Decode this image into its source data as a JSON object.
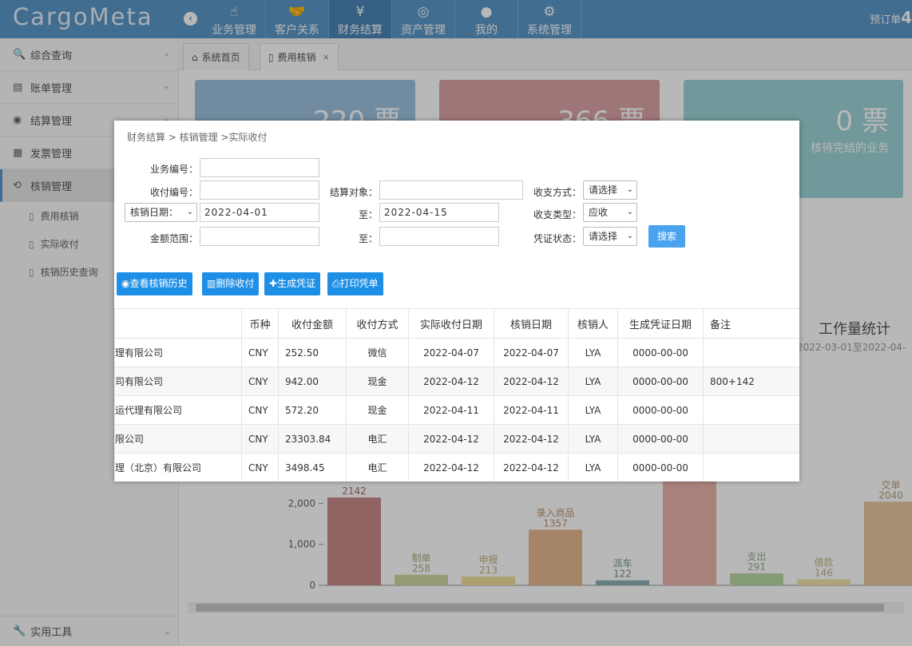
{
  "app": {
    "logo": "CargoMeta",
    "order_label": "预订单",
    "order_count": "4"
  },
  "nav": [
    {
      "label": "业务管理",
      "icon": "hand-pointer-icon"
    },
    {
      "label": "客户关系",
      "icon": "handshake-icon"
    },
    {
      "label": "财务结算",
      "icon": "yen-icon",
      "active": true
    },
    {
      "label": "资产管理",
      "icon": "basketball-icon"
    },
    {
      "label": "我的",
      "icon": "user-icon"
    },
    {
      "label": "系统管理",
      "icon": "gear-icon"
    }
  ],
  "sidebar": {
    "items": [
      {
        "label": "综合查询",
        "icon": "search-icon"
      },
      {
        "label": "账单管理",
        "icon": "list-icon"
      },
      {
        "label": "结算管理",
        "icon": "coins-icon"
      },
      {
        "label": "发票管理",
        "icon": "invoice-icon"
      },
      {
        "label": "核销管理",
        "icon": "refresh-icon",
        "active": true
      }
    ],
    "subitems": [
      {
        "label": "费用核销",
        "icon": "file-icon"
      },
      {
        "label": "实际收付",
        "icon": "file-icon"
      },
      {
        "label": "核销历史查询",
        "icon": "file-icon"
      }
    ],
    "bottom": {
      "label": "实用工具",
      "icon": "wrench-icon"
    }
  },
  "tabs": [
    {
      "label": "系统首页",
      "icon": "home-icon"
    },
    {
      "label": "费用核销",
      "icon": "file-icon",
      "active": true,
      "close": "×"
    }
  ],
  "stats": [
    {
      "value": "220 票",
      "caption": "",
      "color": "#9dc3df"
    },
    {
      "value": "366 票",
      "caption": "",
      "color": "#dba4a6"
    },
    {
      "value": "0 票",
      "caption": "核待完结的业务",
      "color": "#9dd3d6"
    }
  ],
  "workload": {
    "title": "工作量统计",
    "range": "2022-03-01至2022-04-"
  },
  "chart_data": {
    "type": "bar",
    "ylim": [
      0,
      2600
    ],
    "yticks": [
      "0",
      "1,000",
      "2,000"
    ],
    "categories": [
      "",
      "制单",
      "申报",
      "录入商品",
      "派车",
      "",
      "支出",
      "借款",
      "交单"
    ],
    "values": [
      2142,
      258,
      213,
      1357,
      122,
      2600,
      291,
      146,
      2040
    ],
    "labels": [
      "2142",
      "258",
      "213",
      "1357",
      "122",
      "",
      "291",
      "146",
      "2040"
    ],
    "colors": [
      "#c98a89",
      "#cdd9a1",
      "#f1de9c",
      "#e7b891",
      "#8fb1b5",
      "#e9b5ab",
      "#b9d8a5",
      "#f3e2a8",
      "#e8c69d"
    ]
  },
  "modal": {
    "breadcrumb": "财务结算 > 核销管理 >实际收付",
    "form": {
      "biz_no_label": "业务编号：",
      "biz_no_value": "",
      "pay_no_label": "收付编号：",
      "pay_no_value": "",
      "target_label": "结算对象：",
      "target_value": "",
      "method_label": "收支方式：",
      "method_value": "请选择",
      "date_type_value": "核销日期：",
      "date_from": "2022-04-01",
      "to_label": "至：",
      "date_to": "2022-04-15",
      "type_label": "收支类型：",
      "type_value": "应收",
      "amount_label": "金额范围：",
      "amount_from": "",
      "amount_to": "",
      "voucher_label": "凭证状态：",
      "voucher_value": "请选择",
      "search_label": "搜索"
    },
    "actions": {
      "history": "查看核销历史",
      "delete": "删除收付",
      "generate": "生成凭证",
      "print": "打印凭单"
    },
    "table": {
      "headers": [
        "",
        "币种",
        "收付金额",
        "收付方式",
        "实际收付日期",
        "核销日期",
        "核销人",
        "生成凭证日期",
        "备注"
      ],
      "rows": [
        [
          "理有限公司",
          "CNY",
          "252.50",
          "微信",
          "2022-04-07",
          "2022-04-07",
          "LYA",
          "0000-00-00",
          ""
        ],
        [
          "司有限公司",
          "CNY",
          "942.00",
          "现金",
          "2022-04-12",
          "2022-04-12",
          "LYA",
          "0000-00-00",
          "800+142"
        ],
        [
          "运代理有限公司",
          "CNY",
          "572.20",
          "现金",
          "2022-04-11",
          "2022-04-11",
          "LYA",
          "0000-00-00",
          ""
        ],
        [
          "限公司",
          "CNY",
          "23303.84",
          "电汇",
          "2022-04-12",
          "2022-04-12",
          "LYA",
          "0000-00-00",
          ""
        ],
        [
          "理（北京）有限公司",
          "CNY",
          "3498.45",
          "电汇",
          "2022-04-12",
          "2022-04-12",
          "LYA",
          "0000-00-00",
          ""
        ]
      ]
    }
  }
}
